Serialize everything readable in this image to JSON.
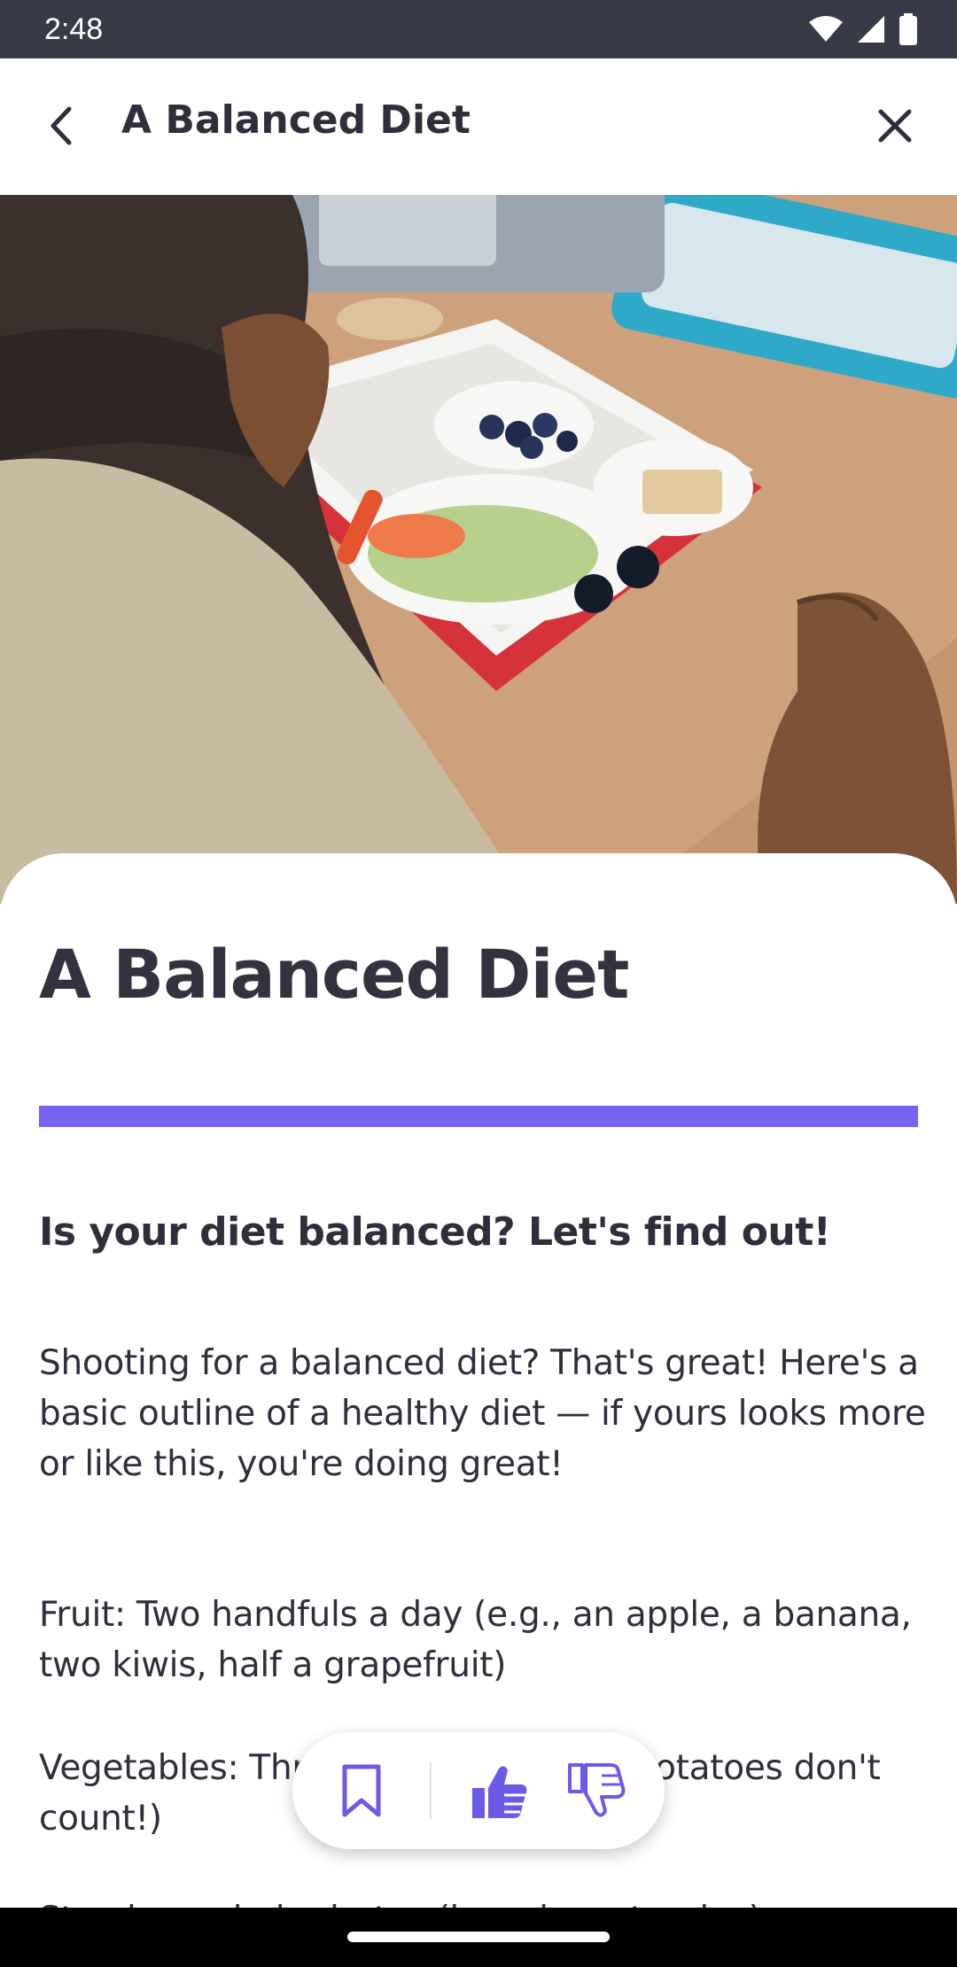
{
  "status_bar": {
    "time": "2:48"
  },
  "app_bar": {
    "title": "A Balanced Diet"
  },
  "article": {
    "title": "A Balanced Diet",
    "accent_color": "#7763f2",
    "subheading": "Is your diet balanced? Let's find out!",
    "intro": "Shooting for a balanced diet? That's great! Here's a basic outline of a healthy diet — if yours looks more or like this, you're doing great!",
    "fruit": "Fruit: Two handfuls a day (e.g., an apple, a banana, two kiwis, half a grapefruit)",
    "vegetables": "Vegetables: Three handfuls a day (potatoes don't count!)",
    "next_line": "Starchy carbohydrates (bread, pasta, rice)"
  },
  "actions": {
    "bookmark_icon": "bookmark-icon",
    "like_icon": "thumbs-up-icon",
    "dislike_icon": "thumbs-down-icon"
  }
}
